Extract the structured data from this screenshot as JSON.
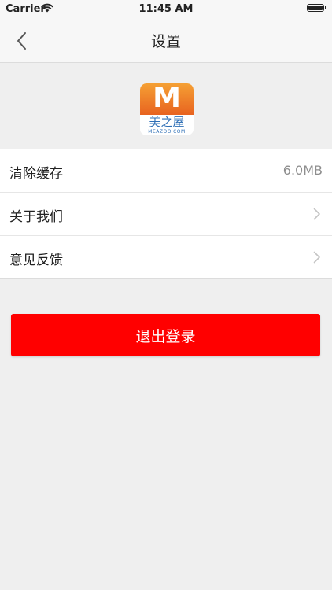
{
  "status_bar": {
    "carrier": "Carrier",
    "time": "11:45 AM",
    "wifi_icon": "wifi-icon",
    "battery_icon": "battery-icon"
  },
  "nav": {
    "title": "设置",
    "back_icon": "chevron-left-icon"
  },
  "logo": {
    "letter": "M",
    "name_cn": "美之屋",
    "name_en": "MEAZOO.COM",
    "colors": {
      "gradient_top": "#f5a034",
      "gradient_bottom": "#e86320",
      "text": "#2e6fb6"
    }
  },
  "settings": {
    "items": [
      {
        "label": "清除缓存",
        "value": "6.0MB"
      },
      {
        "label": "关于我们",
        "icon": "chevron-right-icon"
      },
      {
        "label": "意见反馈",
        "icon": "chevron-right-icon"
      }
    ]
  },
  "logout": {
    "label": "退出登录",
    "color": "#ff0000"
  },
  "colors": {
    "background": "#efefef",
    "nav_background": "#f7f7f7",
    "secondary_text": "#8e8e8e"
  }
}
